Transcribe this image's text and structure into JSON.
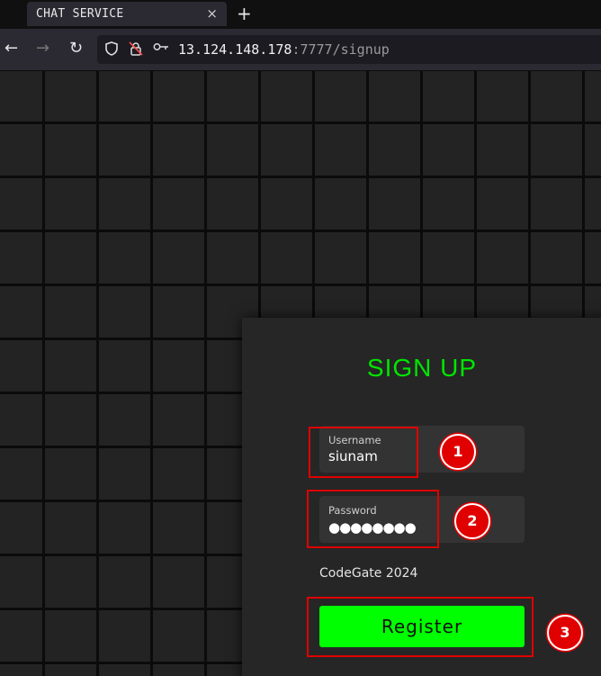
{
  "browser": {
    "tab_title": "CHAT SERVICE",
    "tab_close": "×",
    "new_tab": "+",
    "url_host": "13.124.148.178",
    "url_rest": ":7777/signup"
  },
  "signup": {
    "title": "SIGN UP",
    "username_label": "Username",
    "username_value": "siunam",
    "password_label": "Password",
    "password_value": "●●●●●●●●",
    "footer": "CodeGate 2024",
    "register_label": "Register"
  },
  "annotations": [
    "1",
    "2",
    "3"
  ],
  "colors": {
    "accent": "#00ff00",
    "title": "#00e600",
    "annotation": "#e00000",
    "panel": "#262626",
    "field": "#333333"
  }
}
